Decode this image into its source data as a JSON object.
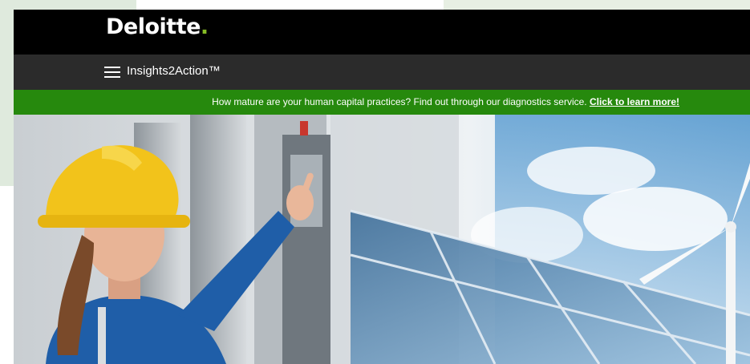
{
  "header": {
    "logo_text": "Deloitte",
    "logo_dot": ".",
    "brand_color": "#86bc25"
  },
  "nav": {
    "menu_icon": "hamburger-menu-icon",
    "title": "Insights2Action™"
  },
  "banner": {
    "message": "How mature are your human capital practices? Find out through our diagnostics service. ",
    "link_label": "Click to learn more!",
    "background": "#26890d"
  },
  "hero": {
    "image": "hero-image"
  }
}
